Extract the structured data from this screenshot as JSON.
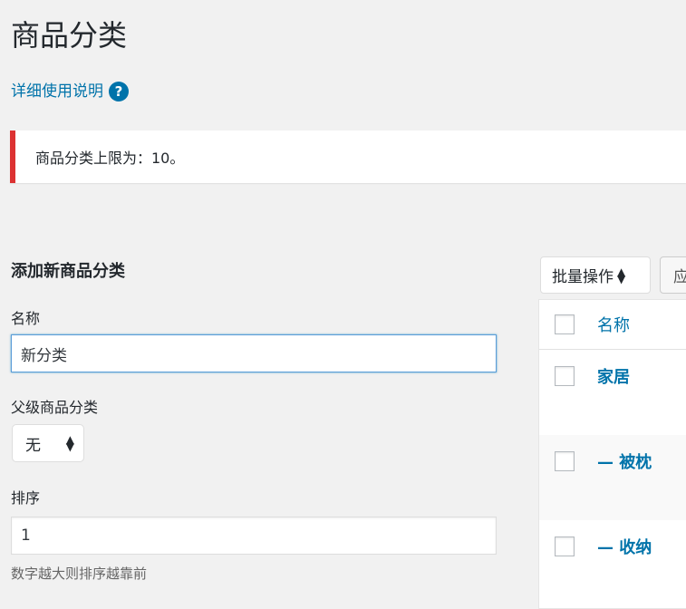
{
  "page": {
    "title": "商品分类",
    "help_link": "详细使用说明",
    "help_icon_glyph": "?"
  },
  "notice": {
    "text": "商品分类上限为：10。",
    "color": "#dc3232"
  },
  "form": {
    "title": "添加新商品分类",
    "name_label": "名称",
    "name_value": "新分类",
    "parent_label": "父级商品分类",
    "parent_selected": "无",
    "order_label": "排序",
    "order_value": "1",
    "order_description": "数字越大则排序越靠前"
  },
  "table": {
    "bulk_actions": "批量操作",
    "apply_button": "应",
    "column_name": "名称",
    "rows": [
      {
        "name": "家居"
      },
      {
        "name": "— 被枕"
      },
      {
        "name": "— 收纳"
      }
    ]
  },
  "colors": {
    "link": "#0073aa",
    "background": "#f1f1f1",
    "focus_border": "#5b9dd9"
  }
}
